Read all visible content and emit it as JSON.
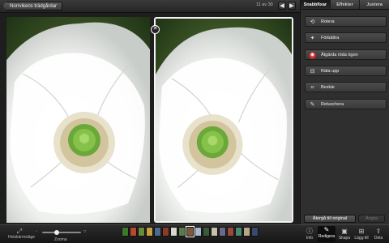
{
  "topbar": {
    "album_label": "Norrvikens trädgårdar",
    "counter": "11 av 30",
    "prev_icon": "arrow-left-icon",
    "next_icon": "arrow-right-icon"
  },
  "panel": {
    "tabs": [
      {
        "label": "Snabbfixar",
        "active": true
      },
      {
        "label": "Effekter",
        "active": false
      },
      {
        "label": "Justera",
        "active": false
      }
    ],
    "tools": [
      {
        "label": "Rotera",
        "icon": "rotate-icon"
      },
      {
        "label": "Förbättra",
        "icon": "magic-wand-icon"
      },
      {
        "label": "Åtgärda röda ögon",
        "icon": "red-eye-icon"
      },
      {
        "label": "Räta upp",
        "icon": "straighten-icon"
      },
      {
        "label": "Beskär",
        "icon": "crop-icon"
      },
      {
        "label": "Retuschera",
        "icon": "retouch-brush-icon"
      }
    ],
    "revert_label": "Återgå till original",
    "undo_label": "Ångra"
  },
  "bottombar": {
    "fullscreen_label": "Helskärmsläge",
    "zoom_label": "Zooma",
    "zoom_level": 0.35,
    "tools": [
      {
        "label": "Info",
        "icon": "info-icon",
        "active": false
      },
      {
        "label": "Redigera",
        "icon": "brush-icon",
        "active": true
      },
      {
        "label": "Skapa",
        "icon": "book-icon",
        "active": false
      },
      {
        "label": "Lägg till",
        "icon": "add-to-icon",
        "active": false
      },
      {
        "label": "Dela",
        "icon": "share-icon",
        "active": false
      }
    ],
    "thumbnail_colors": [
      "#3c7a2a",
      "#b84830",
      "#6a8c3a",
      "#c8a040",
      "#4a6a90",
      "#8a3a2a",
      "#d8d8d0",
      "#5a7a4a",
      "#7a5a3a",
      "#a8b8c8",
      "#3a5a3a",
      "#c8c0a8",
      "#6a6a8a",
      "#9a4a3a",
      "#4a8a6a",
      "#b8a888",
      "#3a4a6a"
    ],
    "selected_thumbnail": 8
  },
  "colors": {
    "accent_red": "#c8282a",
    "selection_border": "#f2f2f2"
  }
}
